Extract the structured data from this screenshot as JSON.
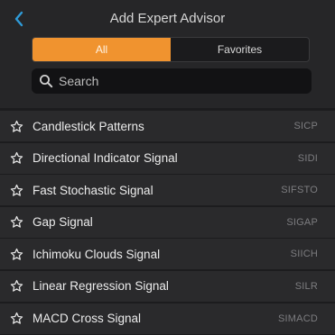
{
  "header": {
    "title": "Add Expert Advisor"
  },
  "tabs": [
    {
      "label": "All"
    },
    {
      "label": "Favorites"
    }
  ],
  "search": {
    "placeholder": "Search"
  },
  "colors": {
    "accent": "#f0932f",
    "back": "#2f9bd8"
  },
  "advisors": [
    {
      "name": "Candlestick Patterns",
      "code": "SICP"
    },
    {
      "name": "Directional Indicator Signal",
      "code": "SIDI"
    },
    {
      "name": "Fast Stochastic Signal",
      "code": "SIFSTO"
    },
    {
      "name": "Gap Signal",
      "code": "SIGAP"
    },
    {
      "name": "Ichimoku Clouds Signal",
      "code": "SIICH"
    },
    {
      "name": "Linear Regression Signal",
      "code": "SILR"
    },
    {
      "name": "MACD Cross Signal",
      "code": "SIMACD"
    }
  ]
}
